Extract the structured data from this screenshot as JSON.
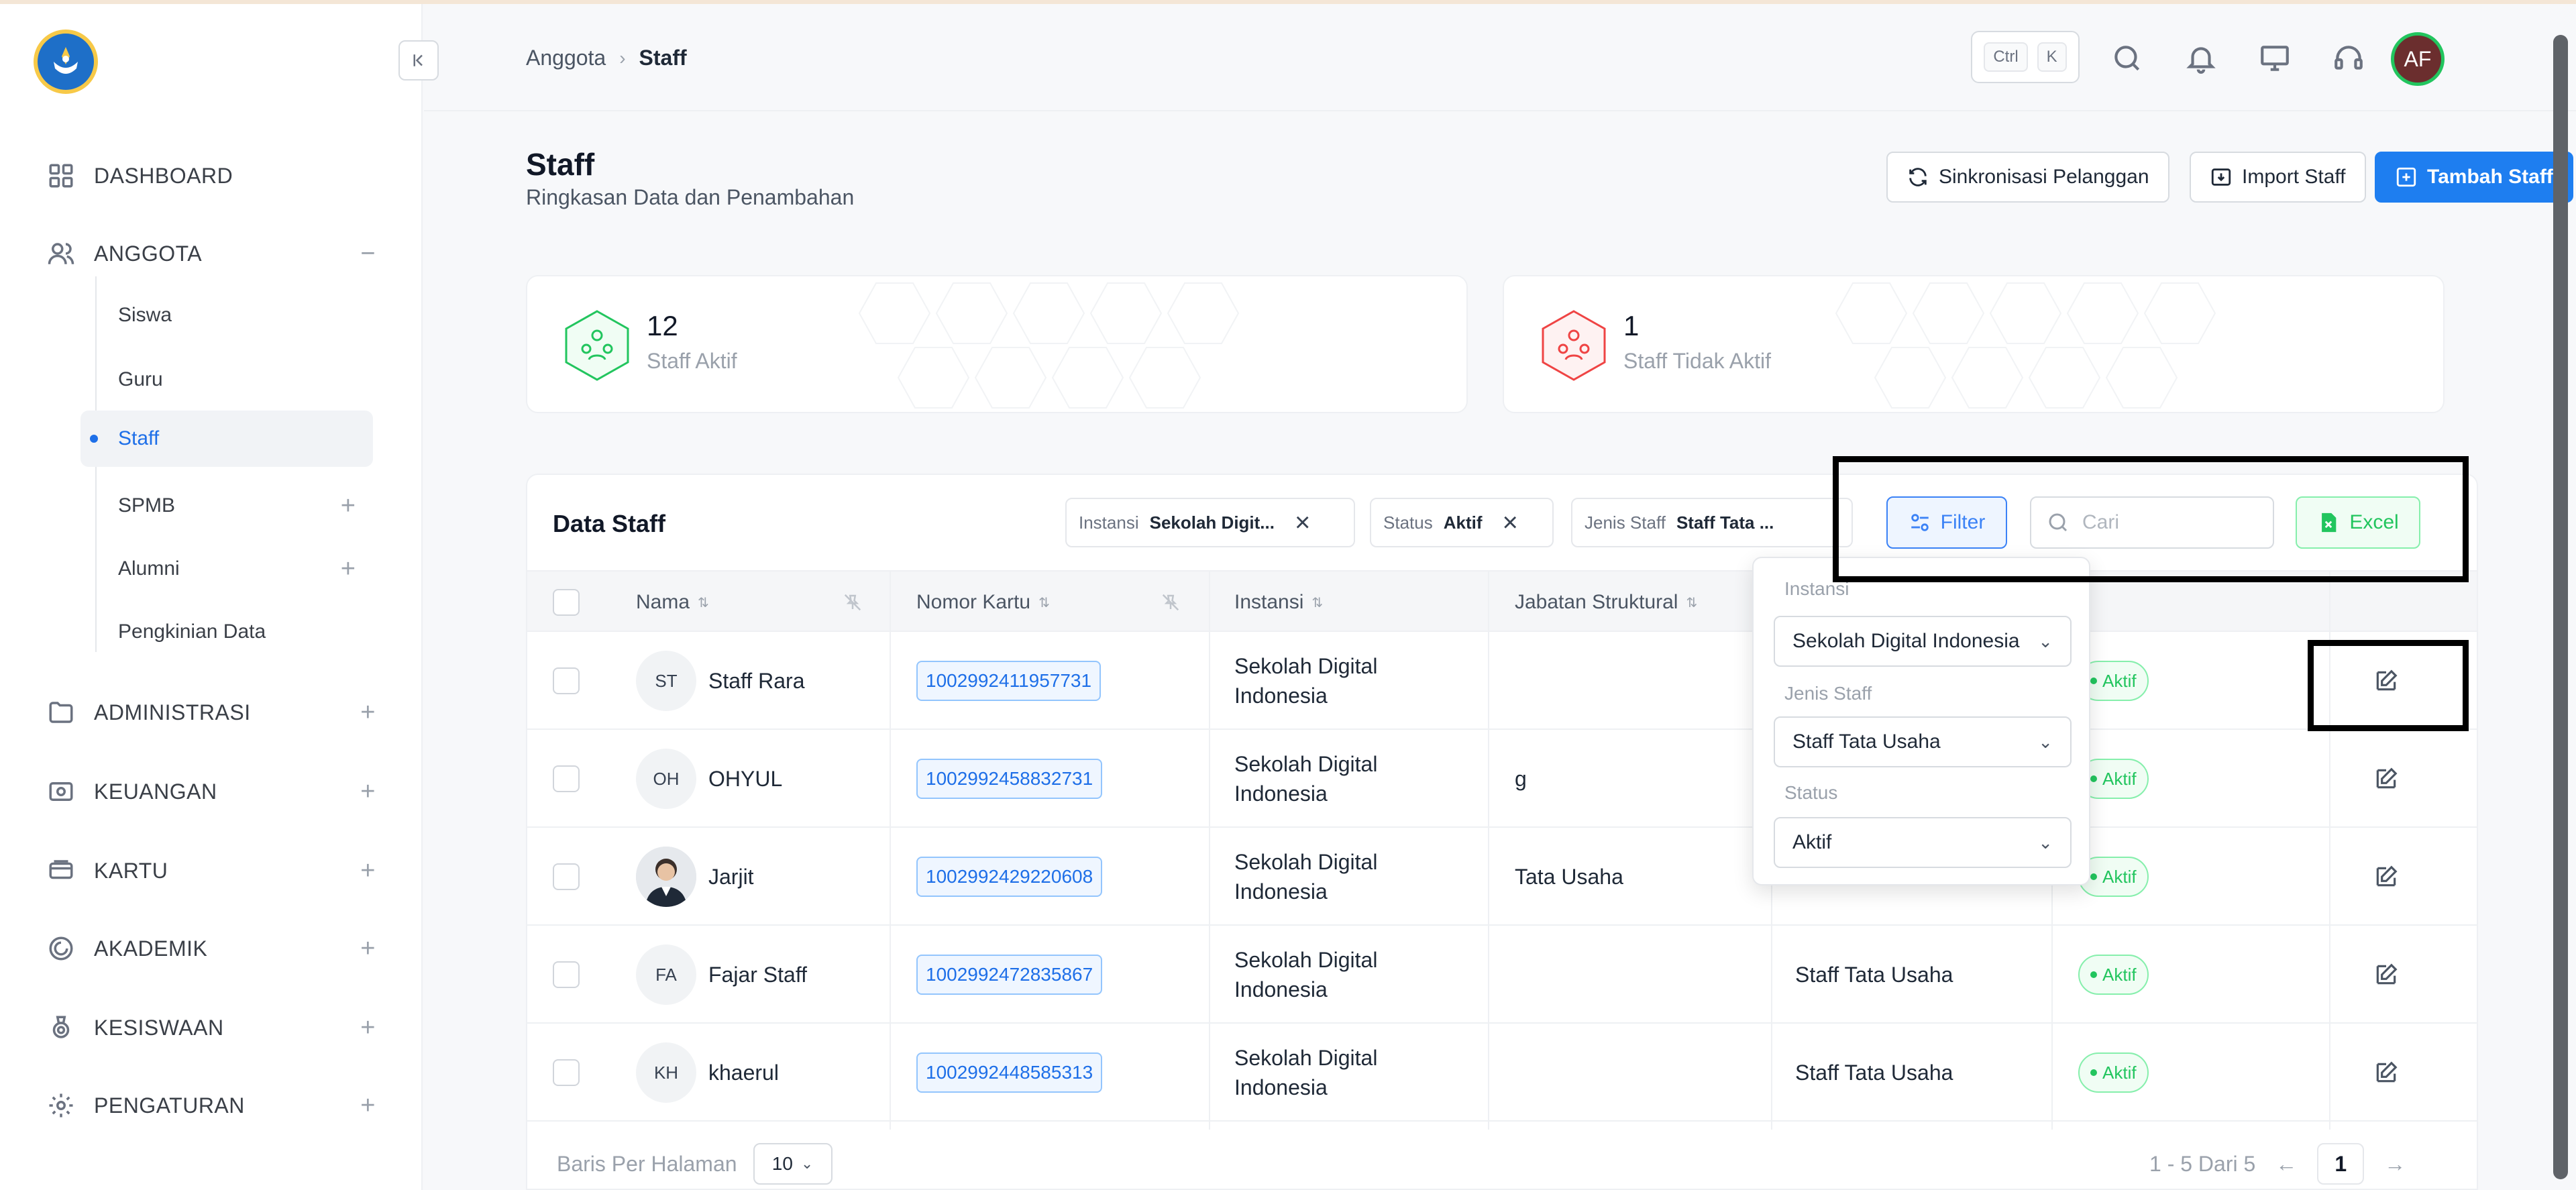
{
  "sidebar": {
    "collapse_icon": "collapse-left-icon",
    "items": [
      {
        "label": "DASHBOARD",
        "icon": "grid-icon"
      },
      {
        "label": "ANGGOTA",
        "icon": "users-icon",
        "expanded": true,
        "children": [
          "Siswa",
          "Guru",
          "Staff",
          "SPMB",
          "Alumni",
          "Pengkinian Data"
        ],
        "active_child": "Staff"
      },
      {
        "label": "ADMINISTRASI",
        "icon": "folder-icon"
      },
      {
        "label": "KEUANGAN",
        "icon": "wallet-icon"
      },
      {
        "label": "KARTU",
        "icon": "card-icon"
      },
      {
        "label": "AKADEMIK",
        "icon": "academic-icon"
      },
      {
        "label": "KESISWAAN",
        "icon": "badge-icon"
      },
      {
        "label": "PENGATURAN",
        "icon": "gear-icon"
      }
    ]
  },
  "header": {
    "breadcrumb": [
      "Anggota",
      "Staff"
    ],
    "shortcut": [
      "Ctrl",
      "K"
    ],
    "avatar_initials": "AF"
  },
  "page": {
    "title": "Staff",
    "subtitle": "Ringkasan Data dan Penambahan",
    "buttons": {
      "sync": "Sinkronisasi Pelanggan",
      "import": "Import Staff",
      "add": "Tambah Staff"
    }
  },
  "stats": [
    {
      "value": "12",
      "label": "Staff Aktif",
      "color": "#22c55e"
    },
    {
      "value": "1",
      "label": "Staff Tidak Aktif",
      "color": "#ef4444"
    }
  ],
  "table": {
    "title": "Data Staff",
    "chips": [
      {
        "key": "Instansi",
        "value": "Sekolah Digit..."
      },
      {
        "key": "Status",
        "value": "Aktif"
      },
      {
        "key": "Jenis Staff",
        "value": "Staff Tata ..."
      }
    ],
    "filter_label": "Filter",
    "search_placeholder": "Cari",
    "excel_label": "Excel",
    "columns": [
      "Nama",
      "Nomor Kartu",
      "Instansi",
      "Jabatan Struktural"
    ],
    "rows": [
      {
        "initials": "ST",
        "name": "Staff Rara",
        "card": "1002992411957731",
        "instansi1": "Sekolah Digital",
        "instansi2": "Indonesia",
        "jabatan": "",
        "jenis": "",
        "status": "Aktif"
      },
      {
        "initials": "OH",
        "name": "OHYUL",
        "card": "1002992458832731",
        "instansi1": "Sekolah Digital",
        "instansi2": "Indonesia",
        "jabatan": "g",
        "jenis": "",
        "status": "Aktif"
      },
      {
        "initials": "",
        "name": "Jarjit",
        "card": "1002992429220608",
        "instansi1": "Sekolah Digital",
        "instansi2": "Indonesia",
        "jabatan": "Tata Usaha",
        "jenis": "",
        "status": "Aktif"
      },
      {
        "initials": "FA",
        "name": "Fajar Staff",
        "card": "1002992472835867",
        "instansi1": "Sekolah Digital",
        "instansi2": "Indonesia",
        "jabatan": "",
        "jenis": "Staff Tata Usaha",
        "status": "Aktif"
      },
      {
        "initials": "KH",
        "name": "khaerul",
        "card": "1002992448585313",
        "instansi1": "Sekolah Digital",
        "instansi2": "Indonesia",
        "jabatan": "",
        "jenis": "Staff Tata Usaha",
        "status": "Aktif"
      }
    ],
    "footer": {
      "rows_per_page_label": "Baris Per Halaman",
      "rows_per_page": "10",
      "range": "1 - 5 Dari 5",
      "current_page": "1"
    }
  },
  "filter_dropdown": {
    "fields": [
      {
        "label": "Instansi",
        "value": "Sekolah Digital Indonesia"
      },
      {
        "label": "Jenis Staff",
        "value": "Staff Tata Usaha"
      },
      {
        "label": "Status",
        "value": "Aktif"
      }
    ]
  },
  "colors": {
    "primary": "#1e7ef0",
    "success": "#22c55e",
    "danger": "#ef4444"
  }
}
